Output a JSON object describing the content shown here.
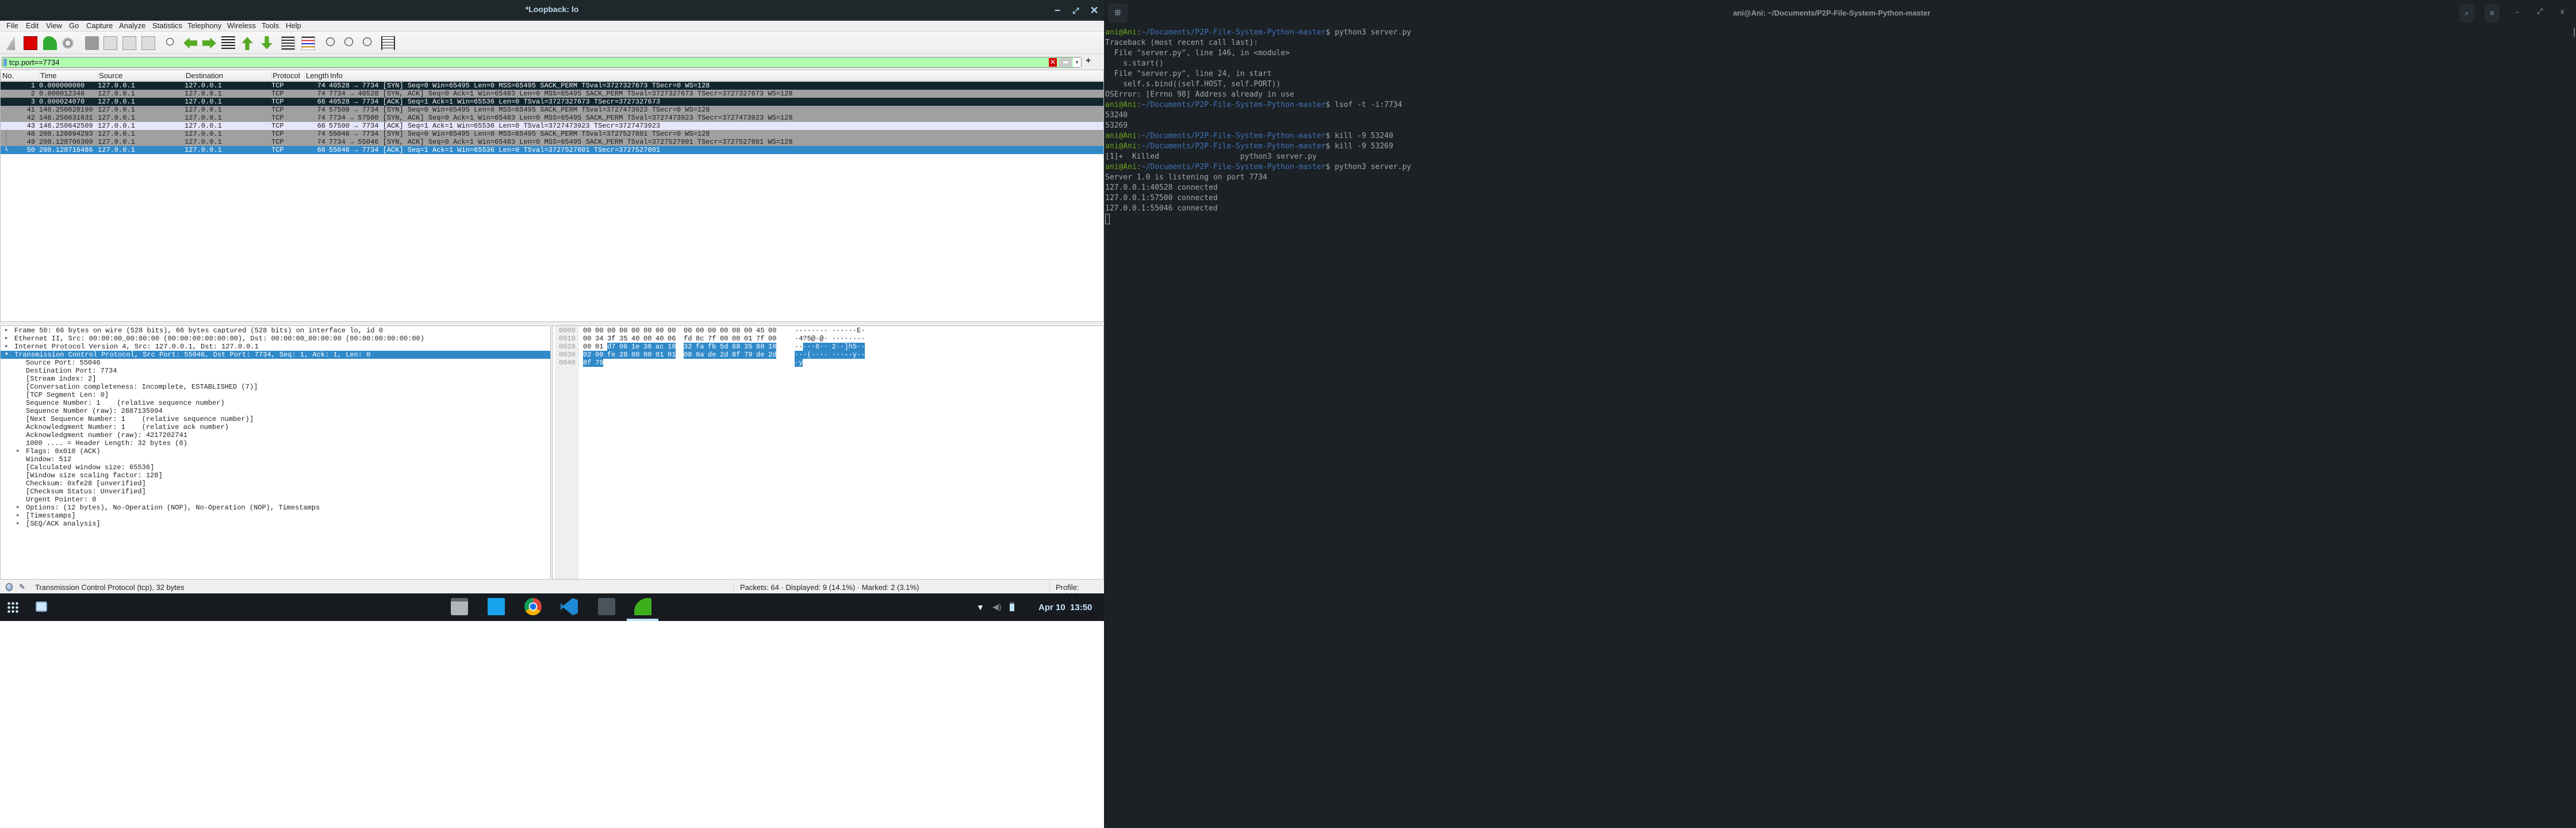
{
  "wireshark": {
    "title": "*Loopback: lo",
    "window_controls": {
      "minimize": "−",
      "maximize": "⤢",
      "close": "✕"
    },
    "menu": [
      "File",
      "Edit",
      "View",
      "Go",
      "Capture",
      "Analyze",
      "Statistics",
      "Telephony",
      "Wireless",
      "Tools",
      "Help"
    ],
    "toolbar_icons": [
      "start-capture-icon",
      "stop-capture-icon",
      "restart-capture-icon",
      "capture-options-icon",
      "open-file-icon",
      "save-file-icon",
      "close-file-icon",
      "reload-file-icon",
      "find-packet-icon",
      "go-back-icon",
      "go-forward-icon",
      "go-to-packet-icon",
      "go-first-icon",
      "go-last-icon",
      "autoscroll-icon",
      "colorize-icon",
      "zoom-in-icon",
      "zoom-out-icon",
      "zoom-normal-icon",
      "resize-columns-icon"
    ],
    "filter": {
      "value": "tcp.port==7734",
      "add_label": "+"
    },
    "columns": [
      "No.",
      "Time",
      "Source",
      "Destination",
      "Protocol",
      "Length",
      "Info"
    ],
    "packets": [
      {
        "no": "1",
        "time": "0.000000000",
        "src": "127.0.0.1",
        "dst": "127.0.0.1",
        "proto": "TCP",
        "len": "74",
        "info": "40528 → 7734 [SYN] Seq=0 Win=65495 Len=0 MSS=65495 SACK_PERM TSval=3727327673 TSecr=0 WS=128",
        "style": "dark"
      },
      {
        "no": "2",
        "time": "0.000012346",
        "src": "127.0.0.1",
        "dst": "127.0.0.1",
        "proto": "TCP",
        "len": "74",
        "info": "7734 → 40528 [SYN, ACK] Seq=0 Ack=1 Win=65483 Len=0 MSS=65495 SACK_PERM TSval=3727327673 TSecr=3727327673 WS=128",
        "style": "gray"
      },
      {
        "no": "3",
        "time": "0.000024070",
        "src": "127.0.0.1",
        "dst": "127.0.0.1",
        "proto": "TCP",
        "len": "66",
        "info": "40528 → 7734 [ACK] Seq=1 Ack=1 Win=65536 Len=0 TSval=3727327673 TSecr=3727327673",
        "style": "dark"
      },
      {
        "no": "41",
        "time": "146.250620190",
        "src": "127.0.0.1",
        "dst": "127.0.0.1",
        "proto": "TCP",
        "len": "74",
        "info": "57500 → 7734 [SYN] Seq=0 Win=65495 Len=0 MSS=65495 SACK_PERM TSval=3727473923 TSecr=0 WS=128",
        "style": "gray"
      },
      {
        "no": "42",
        "time": "146.250631631",
        "src": "127.0.0.1",
        "dst": "127.0.0.1",
        "proto": "TCP",
        "len": "74",
        "info": "7734 → 57500 [SYN, ACK] Seq=0 Ack=1 Win=65483 Len=0 MSS=65495 SACK_PERM TSval=3727473923 TSecr=3727473923 WS=128",
        "style": "gray"
      },
      {
        "no": "43",
        "time": "146.250642509",
        "src": "127.0.0.1",
        "dst": "127.0.0.1",
        "proto": "TCP",
        "len": "66",
        "info": "57500 → 7734 [ACK] Seq=1 Ack=1 Win=65536 Len=0 TSval=3727473923 TSecr=3727473923",
        "style": "lav"
      },
      {
        "no": "48",
        "time": "200.128694293",
        "src": "127.0.0.1",
        "dst": "127.0.0.1",
        "proto": "TCP",
        "len": "74",
        "info": "55046 → 7734 [SYN] Seq=0 Win=65495 Len=0 MSS=65495 SACK_PERM TSval=3727527801 TSecr=0 WS=128",
        "style": "gray"
      },
      {
        "no": "49",
        "time": "200.128706309",
        "src": "127.0.0.1",
        "dst": "127.0.0.1",
        "proto": "TCP",
        "len": "74",
        "info": "7734 → 55046 [SYN, ACK] Seq=0 Ack=1 Win=65483 Len=0 MSS=65495 SACK_PERM TSval=3727527801 TSecr=3727527801 WS=128",
        "style": "gray"
      },
      {
        "no": "50",
        "time": "200.128716486",
        "src": "127.0.0.1",
        "dst": "127.0.0.1",
        "proto": "TCP",
        "len": "66",
        "info": "55046 → 7734 [ACK] Seq=1 Ack=1 Win=65536 Len=0 TSval=3727527801 TSecr=3727527801",
        "style": "sel"
      }
    ],
    "details": [
      {
        "text": "Frame 50: 66 bytes on wire (528 bits), 66 bytes captured (528 bits) on interface lo, id 0",
        "level": 0,
        "expander": "collapsed"
      },
      {
        "text": "Ethernet II, Src: 00:00:00_00:00:00 (00:00:00:00:00:00), Dst: 00:00:00_00:00:00 (00:00:00:00:00:00)",
        "level": 0,
        "expander": "collapsed"
      },
      {
        "text": "Internet Protocol Version 4, Src: 127.0.0.1, Dst: 127.0.0.1",
        "level": 0,
        "expander": "collapsed"
      },
      {
        "text": "Transmission Control Protocol, Src Port: 55046, Dst Port: 7734, Seq: 1, Ack: 1, Len: 0",
        "level": 0,
        "expander": "expanded",
        "selected": true
      },
      {
        "text": "Source Port: 55046",
        "level": 1
      },
      {
        "text": "Destination Port: 7734",
        "level": 1
      },
      {
        "text": "[Stream index: 2]",
        "level": 1
      },
      {
        "text": "[Conversation completeness: Incomplete, ESTABLISHED (7)]",
        "level": 1
      },
      {
        "text": "[TCP Segment Len: 0]",
        "level": 1
      },
      {
        "text": "Sequence Number: 1    (relative sequence number)",
        "level": 1
      },
      {
        "text": "Sequence Number (raw): 2887135994",
        "level": 1
      },
      {
        "text": "[Next Sequence Number: 1    (relative sequence number)]",
        "level": 1
      },
      {
        "text": "Acknowledgment Number: 1    (relative ack number)",
        "level": 1
      },
      {
        "text": "Acknowledgment number (raw): 4217202741",
        "level": 1
      },
      {
        "text": "1000 .... = Header Length: 32 bytes (8)",
        "level": 1
      },
      {
        "text": "Flags: 0x010 (ACK)",
        "level": 1,
        "expander": "collapsed"
      },
      {
        "text": "Window: 512",
        "level": 1
      },
      {
        "text": "[Calculated window size: 65536]",
        "level": 1
      },
      {
        "text": "[Window size scaling factor: 128]",
        "level": 1
      },
      {
        "text": "Checksum: 0xfe28 [unverified]",
        "level": 1
      },
      {
        "text": "[Checksum Status: Unverified]",
        "level": 1
      },
      {
        "text": "Urgent Pointer: 0",
        "level": 1
      },
      {
        "text": "Options: (12 bytes), No-Operation (NOP), No-Operation (NOP), Timestamps",
        "level": 1,
        "expander": "collapsed"
      },
      {
        "text": "[Timestamps]",
        "level": 1,
        "expander": "collapsed"
      },
      {
        "text": "[SEQ/ACK analysis]",
        "level": 1,
        "expander": "collapsed"
      }
    ],
    "hex": [
      {
        "offset": "0000",
        "bytes": [
          "00",
          "00",
          "00",
          "00",
          "00",
          "00",
          "00",
          "00",
          "00",
          "00",
          "00",
          "00",
          "08",
          "00",
          "45",
          "00"
        ],
        "ascii": "········ ······E·",
        "sel_from": 16
      },
      {
        "offset": "0010",
        "bytes": [
          "00",
          "34",
          "3f",
          "35",
          "40",
          "00",
          "40",
          "06",
          "fd",
          "8c",
          "7f",
          "00",
          "00",
          "01",
          "7f",
          "00"
        ],
        "ascii": "·4?5@·@· ········",
        "sel_from": 16
      },
      {
        "offset": "0020",
        "bytes": [
          "00",
          "01",
          "d7",
          "06",
          "1e",
          "36",
          "ac",
          "16",
          "32",
          "fa",
          "fb",
          "5d",
          "68",
          "35",
          "80",
          "10"
        ],
        "ascii": "·····6·· 2··]h5··",
        "sel_from": 2
      },
      {
        "offset": "0030",
        "bytes": [
          "02",
          "00",
          "fe",
          "28",
          "00",
          "00",
          "01",
          "01",
          "08",
          "0a",
          "de",
          "2d",
          "8f",
          "79",
          "de",
          "2d"
        ],
        "ascii": "···(···· ···-·y·-",
        "sel_from": 0
      },
      {
        "offset": "0040",
        "bytes": [
          "8f",
          "79"
        ],
        "ascii": "·y",
        "sel_from": 0
      }
    ],
    "status": {
      "left": "Transmission Control Protocol (tcp), 32 bytes",
      "packets": "Packets: 64 · Displayed: 9 (14.1%) · Marked: 2 (3.1%)",
      "profile": "Profile: Default"
    }
  },
  "taskbar": {
    "apps": [
      "files-icon",
      "software-store-icon",
      "chrome-icon",
      "vscode-icon",
      "terminal-icon",
      "wireshark-icon"
    ],
    "clock": "Apr 10  13:50"
  },
  "terminal": {
    "title": "ani@Ani: ~/Documents/P2P-File-System-Python-master",
    "prompt_user": "ani@Ani",
    "prompt_path": "~/Documents/P2P-File-System-Python-master",
    "lines": [
      {
        "prompt": true,
        "text": "python3 server.py"
      },
      {
        "text": "Traceback (most recent call last):"
      },
      {
        "text": "  File \"server.py\", line 146, in <module>"
      },
      {
        "text": "    s.start()"
      },
      {
        "text": "  File \"server.py\", line 24, in start"
      },
      {
        "text": "    self.s.bind((self.HOST, self.PORT))"
      },
      {
        "text": "OSError: [Errno 98] Address already in use"
      },
      {
        "prompt": true,
        "text": "lsof -t -i:7734"
      },
      {
        "text": "53240"
      },
      {
        "text": "53269"
      },
      {
        "prompt": true,
        "text": "kill -9 53240"
      },
      {
        "prompt": true,
        "text": "kill -9 53269"
      },
      {
        "text": "[1]+  Killed                  python3 server.py"
      },
      {
        "prompt": true,
        "text": "python3 server.py"
      },
      {
        "text": "Server 1.0 is listening on port 7734"
      },
      {
        "text": "127.0.0.1:40528 connected"
      },
      {
        "text": "127.0.0.1:57500 connected"
      },
      {
        "text": "127.0.0.1:55046 connected"
      }
    ]
  }
}
